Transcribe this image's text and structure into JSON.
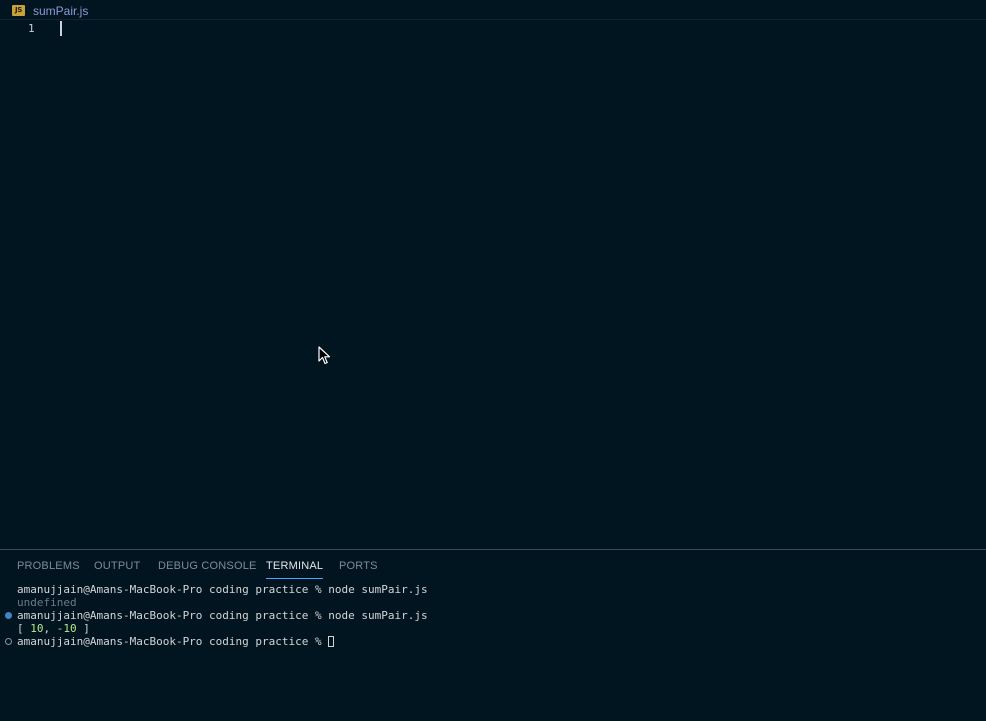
{
  "editor": {
    "tab": {
      "icon_text": "JS",
      "filename": "sumPair.js",
      "icon": "js-file-icon",
      "icon_color": "#c7a13a"
    },
    "lines": [
      {
        "number": "1",
        "text": ""
      }
    ]
  },
  "panel": {
    "tabs": [
      {
        "label": "PROBLEMS"
      },
      {
        "label": "OUTPUT"
      },
      {
        "label": "DEBUG CONSOLE"
      },
      {
        "label": "TERMINAL",
        "active": true
      },
      {
        "label": "PORTS"
      }
    ]
  },
  "terminal": {
    "prompt": "amanujjain@Amans-MacBook-Pro coding practice % ",
    "lines": [
      {
        "command": "node sumPair.js"
      },
      {
        "output": "undefined"
      },
      {
        "command": "node sumPair.js"
      },
      {
        "array_open": "[ ",
        "value_1": "10",
        "separator": ", ",
        "value_2": "-10",
        "array_close": " ]"
      },
      {
        "command": ""
      }
    ]
  },
  "colors": {
    "background": "#011520",
    "active_tab_underline": "#4aa3ff",
    "tab_label": "#8c9bd6",
    "decoration_success": "#3f86c9"
  }
}
